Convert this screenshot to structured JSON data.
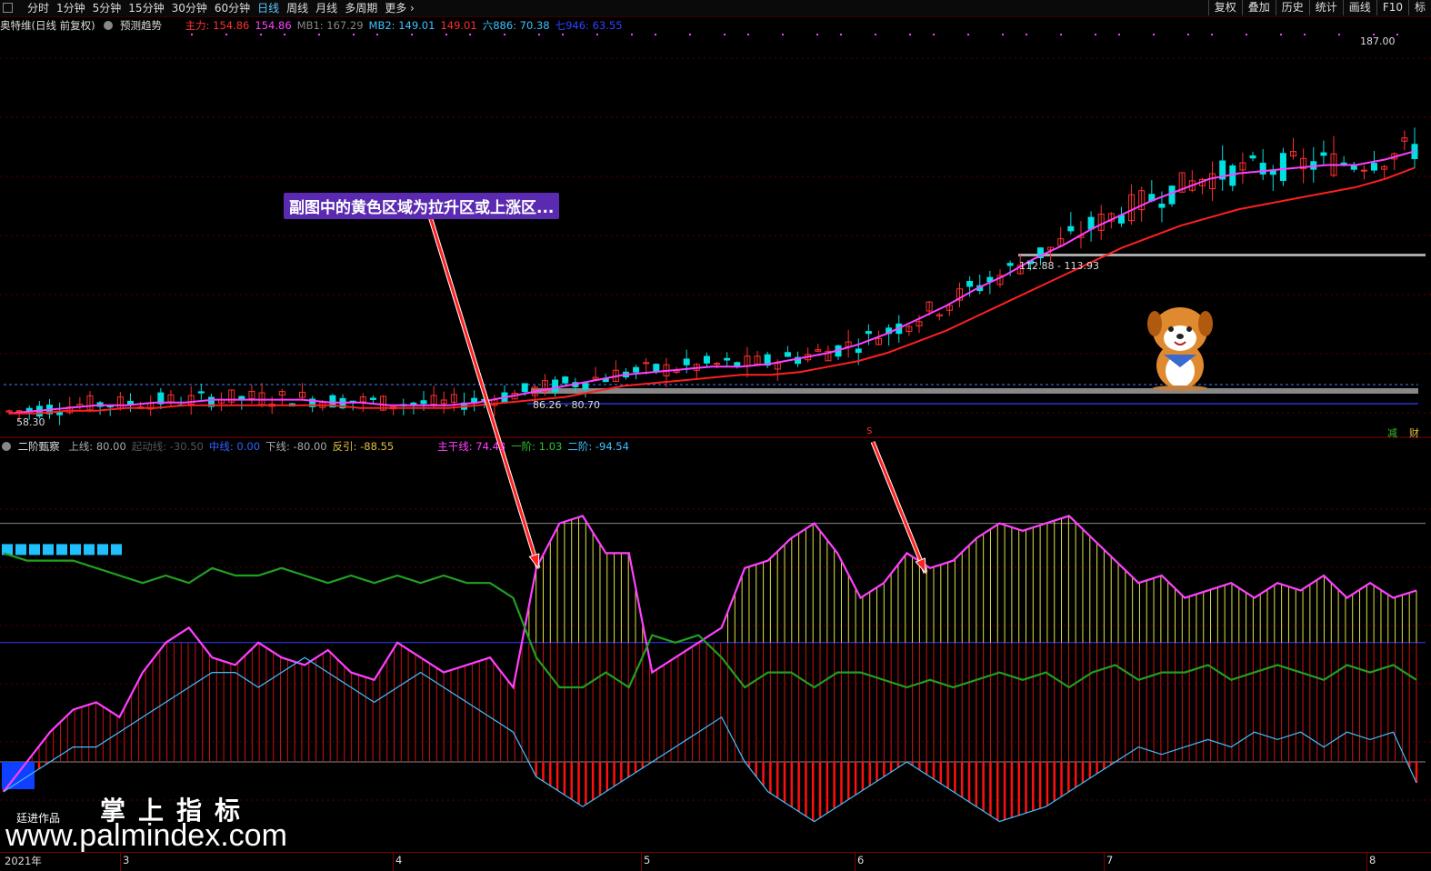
{
  "toolbar": {
    "periods": [
      "分时",
      "1分钟",
      "5分钟",
      "15分钟",
      "30分钟",
      "60分钟",
      "日线",
      "周线",
      "月线",
      "多周期",
      "更多"
    ],
    "active_period": "日线",
    "right_buttons": [
      "复权",
      "叠加",
      "历史",
      "统计",
      "画线",
      "F10",
      "标"
    ]
  },
  "main_header": {
    "stock": "奥特维(日线 前复权)",
    "predict": "预测趋势",
    "items": [
      {
        "label": "主力: 154.86",
        "color": "#ff3030"
      },
      {
        "label": "154.86",
        "color": "#ff40ff"
      },
      {
        "label": "MB1: 167.29",
        "color": "#888888"
      },
      {
        "label": "MB2: 149.01",
        "color": "#40c0ff"
      },
      {
        "label": "149.01",
        "color": "#ff3030"
      },
      {
        "label": "六886: 70.38",
        "color": "#40c0ff"
      },
      {
        "label": "七946: 63.55",
        "color": "#3040ff"
      }
    ]
  },
  "price_labels": {
    "high": "187.00",
    "zone_label": "112.88 - 113.93",
    "low_zone_label": "86.26 - 80.70",
    "low": "58.30"
  },
  "right_tags": [
    "减",
    "财"
  ],
  "sub_header": {
    "title": "二阶甄察",
    "items": [
      {
        "label": "上线: 80.00",
        "color": "#aaaaaa"
      },
      {
        "label": "起动线: -30.50",
        "color": "#555555"
      },
      {
        "label": "中线: 0.00",
        "color": "#3060ff"
      },
      {
        "label": "下线: -80.00",
        "color": "#aaaaaa"
      },
      {
        "label": "反引: -88.55",
        "color": "#e0c040"
      },
      {
        "label": "主干线: 74.43",
        "color": "#ff40ff"
      },
      {
        "label": "一阶: 1.03",
        "color": "#30c030"
      },
      {
        "label": "二阶: -94.54",
        "color": "#40c0ff"
      }
    ]
  },
  "annotation": "副图中的黄色区域为拉升区或上涨区...",
  "marker": "S",
  "watermark": {
    "cn": "掌上指标",
    "url": "www.palmindex.com",
    "author": "廷进作品"
  },
  "date_axis": [
    "2021年",
    "3",
    "4",
    "5",
    "6",
    "7",
    "8"
  ],
  "colors": {
    "up": "#ff3030",
    "down": "#00e0e0",
    "ma_short": "#ff40ff",
    "ma_long": "#ff2020",
    "yellow_zone": "#e0e040",
    "green_line": "#20a020"
  },
  "chart_data": [
    {
      "type": "line",
      "title": "",
      "series": [
        {
          "name": "154.86",
          "values": [
            60,
            61,
            62,
            63,
            63,
            64,
            64,
            65,
            65,
            65,
            65,
            64,
            64,
            63,
            63,
            63,
            64,
            66,
            68,
            70,
            72,
            74,
            75,
            76,
            77,
            77,
            78,
            80,
            82,
            85,
            89,
            94,
            99,
            105,
            110,
            116,
            121,
            127,
            132,
            137,
            141,
            145,
            147,
            148,
            149,
            150,
            150,
            152,
            155
          ]
        },
        {
          "name": "149.01",
          "values": [
            60,
            60,
            61,
            61,
            62,
            62,
            63,
            63,
            63,
            63,
            63,
            63,
            62,
            62,
            62,
            62,
            63,
            64,
            65,
            66,
            68,
            70,
            71,
            72,
            73,
            74,
            74,
            75,
            77,
            79,
            82,
            86,
            90,
            95,
            100,
            105,
            110,
            115,
            120,
            124,
            128,
            131,
            134,
            136,
            138,
            140,
            142,
            145,
            149
          ]
        }
      ],
      "ylim": [
        55,
        190
      ]
    },
    {
      "type": "area",
      "title": "",
      "series": [
        {
          "name": "主干线",
          "values": [
            -100,
            -80,
            -60,
            -45,
            -40,
            -50,
            -20,
            0,
            10,
            -10,
            -15,
            0,
            -10,
            -15,
            -5,
            -20,
            -25,
            0,
            -10,
            -20,
            -15,
            -10,
            -30,
            50,
            80,
            85,
            60,
            60,
            -20,
            -10,
            0,
            10,
            50,
            55,
            70,
            80,
            60,
            30,
            40,
            60,
            50,
            55,
            70,
            80,
            75,
            80,
            85,
            70,
            55,
            40,
            45,
            30,
            35,
            40,
            30,
            40,
            35,
            45,
            30,
            40,
            30,
            35
          ]
        },
        {
          "name": "一阶",
          "values": [
            60,
            55,
            55,
            55,
            50,
            45,
            40,
            45,
            40,
            50,
            45,
            45,
            50,
            45,
            40,
            45,
            40,
            45,
            40,
            45,
            40,
            40,
            30,
            -10,
            -30,
            -30,
            -20,
            -30,
            5,
            0,
            5,
            -10,
            -30,
            -20,
            -20,
            -30,
            -20,
            -20,
            -25,
            -30,
            -25,
            -30,
            -25,
            -20,
            -25,
            -20,
            -30,
            -20,
            -15,
            -25,
            -20,
            -20,
            -15,
            -25,
            -20,
            -15,
            -20,
            -25,
            -15,
            -20,
            -15,
            -25
          ]
        },
        {
          "name": "二阶",
          "values": [
            -100,
            -90,
            -80,
            -70,
            -70,
            -60,
            -50,
            -40,
            -30,
            -20,
            -20,
            -30,
            -20,
            -10,
            -20,
            -30,
            -40,
            -30,
            -20,
            -30,
            -40,
            -50,
            -60,
            -90,
            -100,
            -110,
            -100,
            -90,
            -80,
            -70,
            -60,
            -50,
            -80,
            -100,
            -110,
            -120,
            -110,
            -100,
            -90,
            -80,
            -90,
            -100,
            -110,
            -120,
            -115,
            -110,
            -100,
            -90,
            -80,
            -70,
            -75,
            -70,
            -65,
            -70,
            -60,
            -65,
            -60,
            -70,
            -60,
            -65,
            -60,
            -94
          ]
        }
      ],
      "ylim": [
        -130,
        120
      ]
    }
  ]
}
